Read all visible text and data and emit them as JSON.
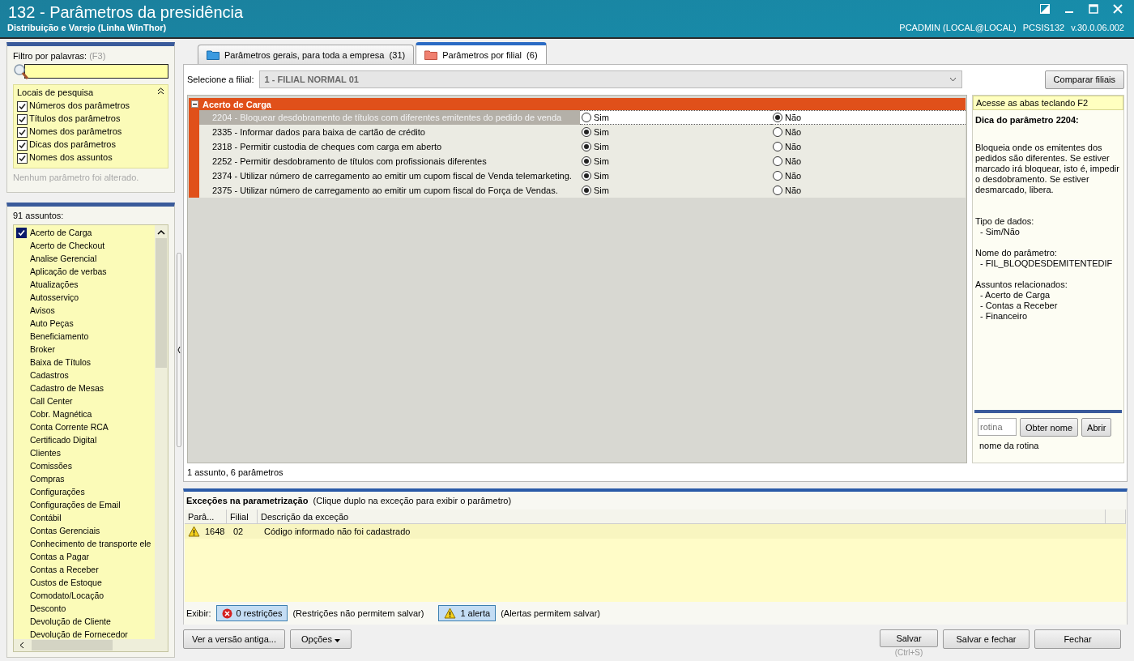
{
  "window": {
    "title": "132 - Parâmetros da presidência",
    "subtitle": "Distribuição e Varejo (Linha WinThor)",
    "user": "PCADMIN (LOCAL@LOCAL)",
    "routine": "PCSIS132",
    "version": "v.30.0.06.002"
  },
  "filter": {
    "label": "Filtro por palavras:",
    "shortcut": "(F3)",
    "search_places": {
      "title": "Locais de pesquisa",
      "expanded": true,
      "options": [
        {
          "label": "Números dos parâmetros",
          "checked": true
        },
        {
          "label": "Títulos dos parâmetros",
          "checked": true
        },
        {
          "label": "Nomes dos parâmetros",
          "checked": true
        },
        {
          "label": "Dicas dos parâmetros",
          "checked": true
        },
        {
          "label": "Nomes dos assuntos",
          "checked": true
        }
      ]
    },
    "status": "Nenhum parâmetro foi alterado."
  },
  "subjects": {
    "count_label": "91 assuntos:",
    "items": [
      {
        "label": "Acerto de Carga",
        "checked": true
      },
      {
        "label": "Acerto de Checkout",
        "checked": false
      },
      {
        "label": "Analise Gerencial",
        "checked": false
      },
      {
        "label": "Aplicação de verbas",
        "checked": false
      },
      {
        "label": "Atualizações",
        "checked": false
      },
      {
        "label": "Autosserviço",
        "checked": false
      },
      {
        "label": "Avisos",
        "checked": false
      },
      {
        "label": "Auto Peças",
        "checked": false
      },
      {
        "label": "Beneficiamento",
        "checked": false
      },
      {
        "label": "Broker",
        "checked": false
      },
      {
        "label": "Baixa de Títulos",
        "checked": false
      },
      {
        "label": "Cadastros",
        "checked": false
      },
      {
        "label": "Cadastro de Mesas",
        "checked": false
      },
      {
        "label": "Call Center",
        "checked": false
      },
      {
        "label": "Cobr. Magnética",
        "checked": false
      },
      {
        "label": "Conta Corrente RCA",
        "checked": false
      },
      {
        "label": "Certificado Digital",
        "checked": false
      },
      {
        "label": "Clientes",
        "checked": false
      },
      {
        "label": "Comissões",
        "checked": false
      },
      {
        "label": "Compras",
        "checked": false
      },
      {
        "label": "Configurações",
        "checked": false
      },
      {
        "label": "Configurações de Email",
        "checked": false
      },
      {
        "label": "Contábil",
        "checked": false
      },
      {
        "label": "Contas Gerenciais",
        "checked": false
      },
      {
        "label": "Conhecimento de transporte ele",
        "checked": false
      },
      {
        "label": "Contas a Pagar",
        "checked": false
      },
      {
        "label": "Contas a Receber",
        "checked": false
      },
      {
        "label": "Custos de Estoque",
        "checked": false
      },
      {
        "label": "Comodato/Locação",
        "checked": false
      },
      {
        "label": "Desconto",
        "checked": false
      },
      {
        "label": "Devolução de Cliente",
        "checked": false
      },
      {
        "label": "Devolução de Fornecedor",
        "checked": false
      }
    ]
  },
  "tabs": [
    {
      "label": "Parâmetros gerais, para toda a empresa",
      "count": "(31)",
      "selected": false
    },
    {
      "label": "Parâmetros por filial",
      "count": "(6)",
      "selected": true
    }
  ],
  "branch": {
    "label": "Selecione a filial:",
    "value": "1 - FILIAL NORMAL 01"
  },
  "compare_button": "Comparar filiais",
  "group": {
    "title": "Acerto de Carga",
    "expanded": true,
    "params": [
      {
        "label": "2204 - Bloquear desdobramento de títulos com diferentes emitentes do pedido de venda",
        "selected": true,
        "options": [
          {
            "label": "Sim",
            "selected": false
          },
          {
            "label": "Não",
            "selected": true
          }
        ]
      },
      {
        "label": "2335 - Informar dados para baixa de cartão de crédito",
        "selected": false,
        "options": [
          {
            "label": "Sim",
            "selected": true
          },
          {
            "label": "Não",
            "selected": false
          }
        ]
      },
      {
        "label": "2318 - Permitir custodia de cheques com carga em aberto",
        "selected": false,
        "options": [
          {
            "label": "Sim",
            "selected": true
          },
          {
            "label": "Não",
            "selected": false
          }
        ]
      },
      {
        "label": "2252 - Permitir desdobramento de títulos com profissionais diferentes",
        "selected": false,
        "options": [
          {
            "label": "Sim",
            "selected": true
          },
          {
            "label": "Não",
            "selected": false
          }
        ]
      },
      {
        "label": "2374 - Utilizar número de carregamento ao emitir um cupom fiscal de Venda telemarketing.",
        "selected": false,
        "options": [
          {
            "label": "Sim",
            "selected": true
          },
          {
            "label": "Não",
            "selected": false
          }
        ]
      },
      {
        "label": "2375 - Utilizar número de carregamento ao emitir um cupom fiscal do Força de Vendas.",
        "selected": false,
        "options": [
          {
            "label": "Sim",
            "selected": true
          },
          {
            "label": "Não",
            "selected": false
          }
        ]
      }
    ]
  },
  "grid_status": "1 assunto, 6 parâmetros",
  "hint": {
    "shortcut": "Acesse as abas teclando F2",
    "title": "Dica do parâmetro 2204:",
    "body": "Bloqueia onde os emitentes dos pedidos são diferentes. Se estiver marcado irá bloquear, isto é, impedir o desdobramento. Se estiver desmarcado, libera.",
    "sections": [
      {
        "heading": "Tipo de dados:",
        "items": [
          "- Sim/Não"
        ]
      },
      {
        "heading": "Nome do parâmetro:",
        "items": [
          "- FIL_BLOQDESDEMITENTEDIF"
        ]
      },
      {
        "heading": "Assuntos relacionados:",
        "items": [
          "- Acerto de Carga",
          "- Contas a Receber",
          "- Financeiro"
        ]
      }
    ]
  },
  "routine_lookup": {
    "placeholder": "rotina",
    "get_name_button": "Obter nome",
    "open_button": "Abrir",
    "result": "nome da rotina"
  },
  "exceptions": {
    "title": "Exceções na parametrização",
    "note": "(Clique duplo na exceção para exibir o parâmetro)",
    "columns": [
      "Parâ...",
      "Filial",
      "Descrição da exceção"
    ],
    "rows": [
      {
        "kind": "alert",
        "cells": [
          "1648",
          "02",
          "Código informado não foi cadastrado"
        ]
      }
    ],
    "show_label": "Exibir:",
    "filters": [
      {
        "kind": "restriction",
        "label": "0 restrições",
        "note": "(Restrições não permitem salvar)",
        "selected": true
      },
      {
        "kind": "alert",
        "label": "1 alerta",
        "note": "(Alertas permitem salvar)",
        "selected": true
      }
    ]
  },
  "footer": {
    "left_buttons": [
      {
        "label": "Ver a versão antiga...",
        "menu": false
      },
      {
        "label": "Opções",
        "menu": true
      }
    ],
    "right_buttons": [
      {
        "label": "Salvar",
        "hint": "(Ctrl+S)"
      },
      {
        "label": "Salvar e fechar"
      },
      {
        "label": "Fechar"
      }
    ]
  }
}
